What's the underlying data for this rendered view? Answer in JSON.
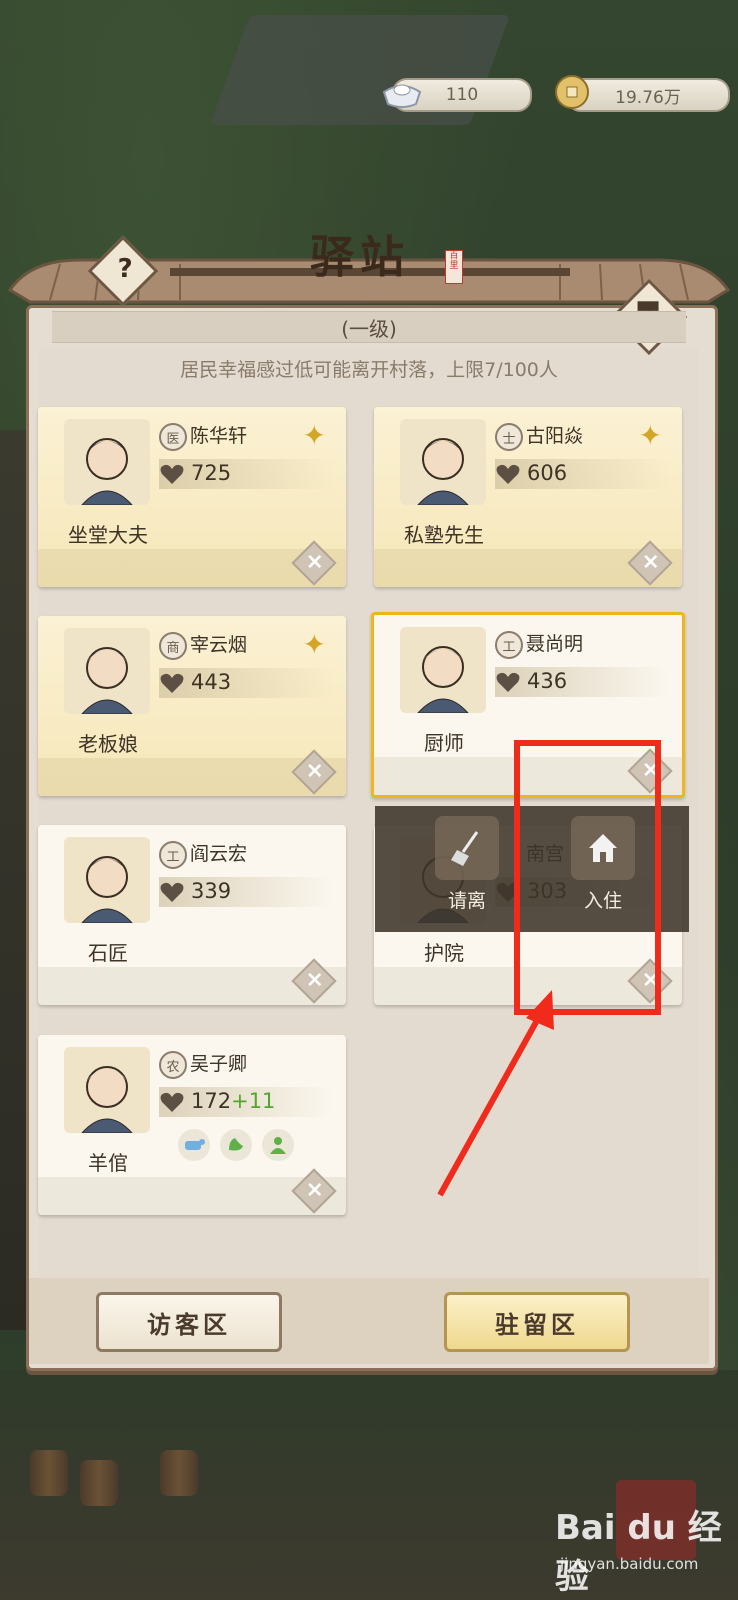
{
  "currency": {
    "silver": "110",
    "coins": "19.76万"
  },
  "header": {
    "title": "驿站",
    "seal_text": "百里",
    "level": "(一级)"
  },
  "capacity_text": "居民幸福感过低可能离开村落，上限7/100人",
  "residents": [
    {
      "badge": "医",
      "name": "陈华轩",
      "score": "725",
      "job": "坐堂大夫"
    },
    {
      "badge": "士",
      "name": "古阳焱",
      "score": "606",
      "job": "私塾先生"
    },
    {
      "badge": "商",
      "name": "宰云烟",
      "score": "443",
      "job": "老板娘"
    },
    {
      "badge": "工",
      "name": "聂尚明",
      "score": "436",
      "job": "厨师"
    },
    {
      "badge": "工",
      "name": "阎云宏",
      "score": "339",
      "job": "石匠"
    },
    {
      "badge": "",
      "name": "南宫",
      "score": "303",
      "job": "护院"
    },
    {
      "badge": "农",
      "name": "吴子卿",
      "score": "172",
      "bonus": "+11",
      "job": "羊倌"
    }
  ],
  "actions": {
    "dismiss": "请离",
    "move_in": "入住"
  },
  "tabs": {
    "visitor": "访客区",
    "stay": "驻留区"
  },
  "watermark": {
    "brand": "Bai du 经验",
    "url": "jingyan.baidu.com"
  },
  "colors": {
    "highlight": "#f12b1c",
    "gold_border": "#f0b51c",
    "bonus_green": "#52a52d"
  }
}
